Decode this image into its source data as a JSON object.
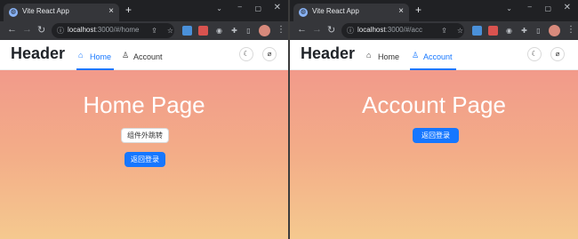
{
  "browser": {
    "tab_title": "Vite React App",
    "window_caret": "⌄",
    "window_minimize": "–",
    "window_maximize": "▢",
    "window_close": "✕"
  },
  "left": {
    "url_host": "localhost",
    "url_path": ":3000/#/home"
  },
  "right": {
    "url_host": "localhost",
    "url_path": ":3000/#/acc"
  },
  "app": {
    "brand": "Header",
    "menu": [
      {
        "label": "Home"
      },
      {
        "label": "Account"
      }
    ]
  },
  "home_page": {
    "title": "Home Page",
    "outside_button": "组件外跳转",
    "back_login_button": "返回登录"
  },
  "account_page": {
    "title": "Account Page",
    "back_login_button": "返回登录"
  },
  "colors": {
    "accent": "#1677ff",
    "gradient_top": "#f29a8a",
    "gradient_bottom": "#f5c98f"
  }
}
